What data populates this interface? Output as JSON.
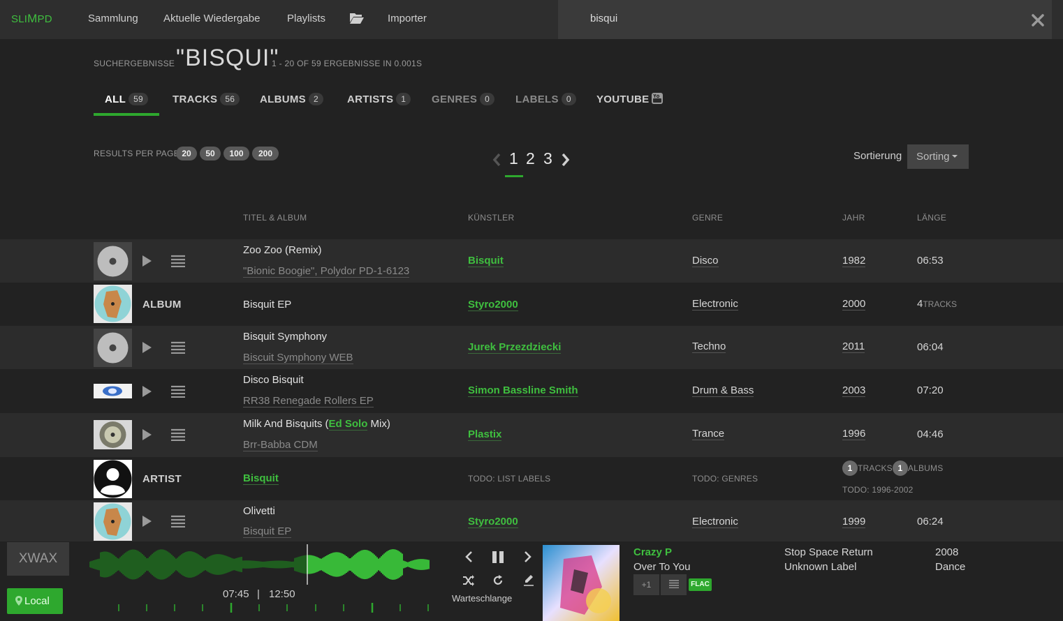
{
  "app": {
    "brand_small1": "SLI",
    "brand_big": "M",
    "brand_small2": "PD"
  },
  "nav": {
    "collection": "Sammlung",
    "now_playing": "Aktuelle Wiedergabe",
    "playlists": "Playlists",
    "importer": "Importer"
  },
  "search": {
    "value": "bisqui"
  },
  "results": {
    "label": "SUCHERGEBNISSE",
    "query": "\"BISQUI\"",
    "count": "1 - 20 OF 59 ERGEBNISSE IN 0.001S"
  },
  "tabs": [
    {
      "label": "ALL",
      "count": "59"
    },
    {
      "label": "TRACKS",
      "count": "56"
    },
    {
      "label": "ALBUMS",
      "count": "2"
    },
    {
      "label": "ARTISTS",
      "count": "1"
    },
    {
      "label": "GENRES",
      "count": "0"
    },
    {
      "label": "LABELS",
      "count": "0"
    },
    {
      "label": "YOUTUBE",
      "count": ""
    }
  ],
  "results_per_page": {
    "label": "RESULTS PER PAGE",
    "options": [
      "20",
      "50",
      "100",
      "200"
    ]
  },
  "pagination": {
    "pages": [
      "1",
      "2",
      "3"
    ],
    "current": "1"
  },
  "sorting": {
    "label": "Sortierung",
    "button": "Sorting"
  },
  "columns": {
    "title_album": "TITEL & ALBUM",
    "artist": "KÜNSTLER",
    "genre": "GENRE",
    "year": "JAHR",
    "length": "LÄNGE"
  },
  "rows": [
    {
      "title": "Zoo Zoo (Remix)",
      "album": "\"Bionic Boogie\", Polydor PD-1-6123",
      "artist": "Bisquit",
      "genre": "Disco",
      "year": "1982",
      "length": "06:53"
    },
    {
      "type": "ALBUM",
      "title": "Bisquit EP",
      "artist": "Styro2000",
      "genre": "Electronic",
      "year": "2000",
      "tracks_count": "4",
      "tracks_label": "TRACKS"
    },
    {
      "title": "Bisquit Symphony",
      "album": "Biscuit Symphony WEB",
      "artist": "Jurek Przezdziecki",
      "genre": "Techno",
      "year": "2011",
      "length": "06:04"
    },
    {
      "title": "Disco Bisquit",
      "album": "RR38 Renegade Rollers EP",
      "artist": "Simon Bassline Smith",
      "genre": "Drum & Bass",
      "year": "2003",
      "length": "07:20"
    },
    {
      "title_pre": "Milk And Bisquits (",
      "title_link": "Ed Solo",
      "title_post": " Mix)",
      "album": "Brr-Babba CDM",
      "artist": "Plastix",
      "genre": "Trance",
      "year": "1996",
      "length": "04:46"
    },
    {
      "type": "ARTIST",
      "title": "Bisquit",
      "labels": "TODO: LIST LABELS",
      "genres": "TODO: GENRES",
      "tracks_count": "1",
      "tracks_label": "TRACKS",
      "albums_count": "1",
      "albums_label": "ALBUMS",
      "years": "TODO: 1996-2002"
    },
    {
      "title": "Olivetti",
      "album": "Bisquit EP",
      "artist": "Styro2000",
      "genre": "Electronic",
      "year": "1999",
      "length": "06:24"
    }
  ],
  "player": {
    "xwax": "XWAX",
    "local": "Local",
    "elapsed": "07:45",
    "separator": "|",
    "total": "12:50",
    "progress": 0.64,
    "queue_label": "Warteschlange",
    "now_playing": {
      "artist": "Crazy P",
      "title": "Over To You",
      "plus_one": "+1",
      "format": "FLAC",
      "album": "Stop Space Return",
      "label": "Unknown Label",
      "year": "2008",
      "genre": "Dance"
    }
  },
  "colors": {
    "accent": "#3fbf3f",
    "bg": "#222222",
    "row_alt": "#2c2c2c"
  }
}
